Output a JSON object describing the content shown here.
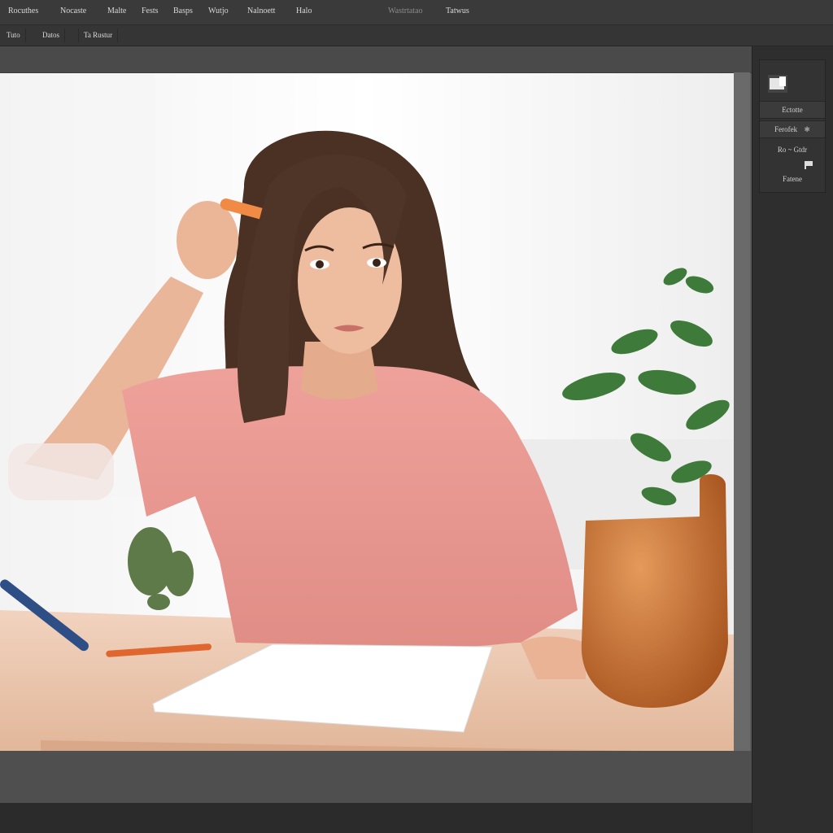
{
  "menu": {
    "items": [
      "Rocuthes",
      "Nocaste",
      "Malte",
      "Fests",
      "Basps",
      "Wutjo",
      "Nalnoett",
      "Halo",
      "Wastrtatao",
      "Tatwus"
    ]
  },
  "tabs": [
    "Tuto",
    "Datos",
    "Ta Rustur"
  ],
  "panel": {
    "title": "Ectotte",
    "row1": "Ferofek",
    "row1_icon": "star-icon",
    "row2": "Ro ~ Gtdr",
    "row3": "Fatene",
    "thumb_icon": "layer-thumbnail-icon",
    "flag_icon": "flag-icon"
  },
  "canvas": {
    "image": "photo-of-woman-at-desk"
  }
}
